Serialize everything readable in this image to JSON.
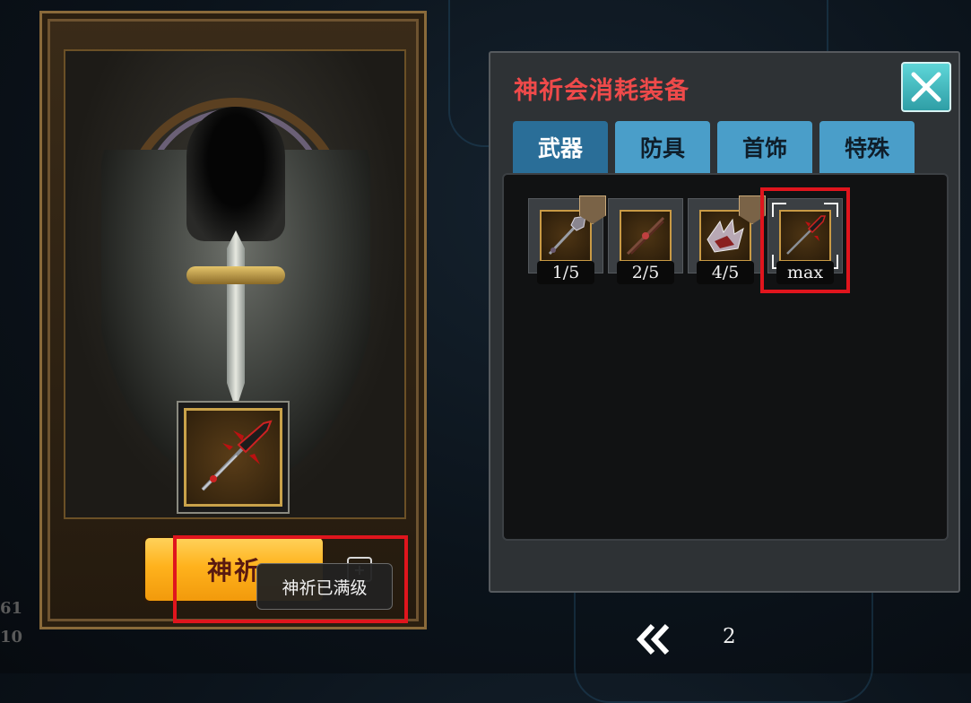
{
  "panel": {
    "title": "神祈会消耗装备",
    "tabs": [
      {
        "label": "武器",
        "active": true
      },
      {
        "label": "防具",
        "active": false
      },
      {
        "label": "首饰",
        "active": false
      },
      {
        "label": "特殊",
        "active": false
      }
    ],
    "items": [
      {
        "icon": "mace-icon",
        "level": "1/5",
        "has_badge": true
      },
      {
        "icon": "staff-icon",
        "level": "2/5",
        "has_badge": false
      },
      {
        "icon": "claw-icon",
        "level": "4/5",
        "has_badge": true
      },
      {
        "icon": "spear-icon",
        "level": "max",
        "selected": true
      }
    ]
  },
  "shrine": {
    "button_label": "神祈",
    "tooltip": "神祈已满级",
    "info_icon": "+",
    "equipped_icon": "spear-icon"
  },
  "side_numbers": [
    "61",
    "10"
  ],
  "pager": {
    "page": "2"
  },
  "colors": {
    "title_red": "#ef4a4a",
    "tab_active": "#2a6e98",
    "tab_inactive": "#4a9ec9",
    "button_gold": "#ffb21d",
    "highlight_red": "#e0151d"
  }
}
